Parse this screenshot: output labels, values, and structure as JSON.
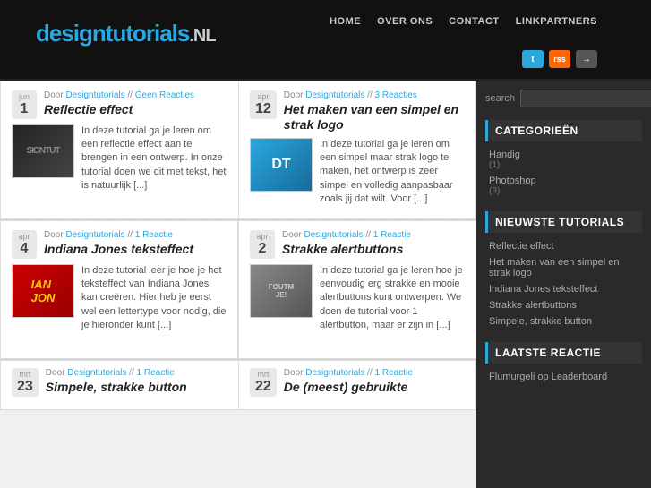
{
  "header": {
    "logo_text": "designtutorials",
    "logo_suffix": ".NL",
    "nav_items": [
      "HOME",
      "OVER ONS",
      "CONTACT",
      "LINKPARTNERS"
    ]
  },
  "social": {
    "twitter_label": "t",
    "rss_label": "rss",
    "share_label": "→"
  },
  "sidebar": {
    "search_label": "search",
    "search_placeholder": "",
    "categories_title": "CATEGORIEËN",
    "categories": [
      {
        "name": "Handig",
        "count": "(1)"
      },
      {
        "name": "Photoshop",
        "count": "(8)"
      }
    ],
    "newest_title": "NIEUWSTE TUTORIALS",
    "newest_items": [
      "Reflectie effect",
      "Het maken van een simpel en strak logo",
      "Indiana Jones teksteffect",
      "Strakke alertbuttons",
      "Simpele, strakke button"
    ],
    "last_reaction_title": "LAATSTE REACTIE",
    "last_reaction_items": [
      "Flumurgeli op Leaderboard"
    ]
  },
  "posts": [
    {
      "id": "post1",
      "month": "jun",
      "day": "1",
      "author": "Designtutorials",
      "reactions": "Geen Reacties",
      "reactions_href": "#",
      "title": "Reflectie effect",
      "excerpt": "In deze tutorial ga je leren om een reflectie effect aan te brengen in een ontwerp. In onze tutorial doen we dit met tekst, het is natuurlijk [...]",
      "thumb_type": "signtut",
      "thumb_text": "SIGNTUT"
    },
    {
      "id": "post2",
      "month": "apr",
      "day": "12",
      "author": "Designtutorials",
      "reactions": "3 Reacties",
      "reactions_href": "#",
      "title": "Het maken van een simpel en strak logo",
      "excerpt": "In deze tutorial ga je leren om een simpel maar strak logo te maken, het ontwerp is zeer simpel en volledig aanpasbaar zoals jij dat wilt. Voor [...]",
      "thumb_type": "dt",
      "thumb_text": "DT"
    },
    {
      "id": "post3",
      "month": "apr",
      "day": "4",
      "author": "Designtutorials",
      "reactions": "1 Reactie",
      "reactions_href": "#",
      "title": "Indiana Jones teksteffect",
      "excerpt": "In deze tutorial leer je hoe je het teksteffect van Indiana Jones kan creëren. Hier heb je eerst wel een lettertype voor nodig, die je hieronder kunt [...]",
      "thumb_type": "indiana",
      "thumb_text": "IAN JO"
    },
    {
      "id": "post4",
      "month": "apr",
      "day": "2",
      "author": "Designtutorials",
      "reactions": "1 Reactie",
      "reactions_href": "#",
      "title": "Strakke alertbuttons",
      "excerpt": "In deze tutorial ga je leren hoe je eenvoudig erg strakke en mooie alertbuttons kunt ontwerpen. We doen de tutorial voor 1 alertbutton, maar er zijn in [...]",
      "thumb_type": "alert",
      "thumb_text": "FOUTM JE!"
    }
  ],
  "bottom_posts": [
    {
      "id": "post5",
      "month": "mrt",
      "day": "23",
      "author": "Designtutorials",
      "reactions": "1 Reactie",
      "title": "Simpele, strakke button"
    },
    {
      "id": "post6",
      "month": "mrt",
      "day": "22",
      "author": "Designtutorials",
      "reactions": "1 Reactie",
      "title": "De (meest) gebruikte"
    }
  ]
}
